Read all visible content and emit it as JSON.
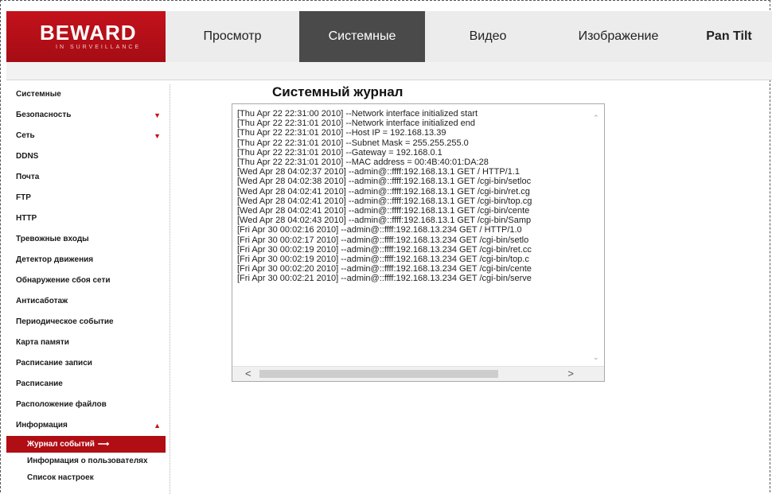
{
  "logo": {
    "brand": "BEWARD",
    "tagline": "IN SURVEILLANCE"
  },
  "nav_tabs": [
    {
      "label": "Просмотр",
      "active": false
    },
    {
      "label": "Системные",
      "active": true
    },
    {
      "label": "Видео",
      "active": false
    },
    {
      "label": "Изображение",
      "active": false
    },
    {
      "label": "Pan Tilt",
      "active": false
    }
  ],
  "sidebar": {
    "items": [
      {
        "label": "Системные",
        "arrow": ""
      },
      {
        "label": "Безопасность",
        "arrow": "▼"
      },
      {
        "label": "Сеть",
        "arrow": "▼"
      },
      {
        "label": "DDNS",
        "arrow": ""
      },
      {
        "label": "Почта",
        "arrow": ""
      },
      {
        "label": "FTP",
        "arrow": ""
      },
      {
        "label": "HTTP",
        "arrow": ""
      },
      {
        "label": "Тревожные входы",
        "arrow": ""
      },
      {
        "label": "Детектор движения",
        "arrow": ""
      },
      {
        "label": "Обнаружение сбоя сети",
        "arrow": ""
      },
      {
        "label": "Антисаботаж",
        "arrow": ""
      },
      {
        "label": "Периодическое событие",
        "arrow": ""
      },
      {
        "label": "Карта памяти",
        "arrow": ""
      },
      {
        "label": "Расписание записи",
        "arrow": ""
      },
      {
        "label": "Расписание",
        "arrow": ""
      },
      {
        "label": "Расположение файлов",
        "arrow": ""
      },
      {
        "label": "Информация",
        "arrow": "▲"
      }
    ],
    "subitems": [
      {
        "label": "Журнал событий",
        "active": true,
        "marker": "⟶"
      },
      {
        "label": "Информация о пользователях",
        "active": false,
        "marker": ""
      },
      {
        "label": "Список настроек",
        "active": false,
        "marker": ""
      }
    ]
  },
  "main": {
    "title": "Системный журнал",
    "log_lines": [
      "[Thu Apr 22 22:31:00 2010] --Network interface initialized start",
      "[Thu Apr 22 22:31:01 2010] --Network interface initialized end",
      "[Thu Apr 22 22:31:01 2010] --Host IP = 192.168.13.39",
      "[Thu Apr 22 22:31:01 2010] --Subnet Mask = 255.255.255.0",
      "[Thu Apr 22 22:31:01 2010] --Gateway = 192.168.0.1",
      "[Thu Apr 22 22:31:01 2010] --MAC address = 00:4B:40:01:DA:28",
      "[Wed Apr 28 04:02:37 2010] --admin@::ffff:192.168.13.1 GET / HTTP/1.1",
      "[Wed Apr 28 04:02:38 2010] --admin@::ffff:192.168.13.1 GET /cgi-bin/setloc",
      "[Wed Apr 28 04:02:41 2010] --admin@::ffff:192.168.13.1 GET /cgi-bin/ret.cg",
      "[Wed Apr 28 04:02:41 2010] --admin@::ffff:192.168.13.1 GET /cgi-bin/top.cg",
      "[Wed Apr 28 04:02:41 2010] --admin@::ffff:192.168.13.1 GET /cgi-bin/cente",
      "[Wed Apr 28 04:02:43 2010] --admin@::ffff:192.168.13.1 GET /cgi-bin/Samp",
      "[Fri Apr 30 00:02:16 2010] --admin@::ffff:192.168.13.234 GET / HTTP/1.0",
      "[Fri Apr 30 00:02:17 2010] --admin@::ffff:192.168.13.234 GET /cgi-bin/setlo",
      "[Fri Apr 30 00:02:19 2010] --admin@::ffff:192.168.13.234 GET /cgi-bin/ret.cc",
      "[Fri Apr 30 00:02:19 2010] --admin@::ffff:192.168.13.234 GET /cgi-bin/top.c",
      "[Fri Apr 30 00:02:20 2010] --admin@::ffff:192.168.13.234 GET /cgi-bin/cente",
      "[Fri Apr 30 00:02:21 2010] --admin@::ffff:192.168.13.234 GET /cgi-bin/serve"
    ],
    "scroll": {
      "up": "⌃",
      "down": "⌄",
      "left": "<",
      "right": ">"
    }
  },
  "colors": {
    "brand_red": "#c4121c",
    "active_tab": "#4a4a4a",
    "active_sidebar": "#b00d15"
  }
}
